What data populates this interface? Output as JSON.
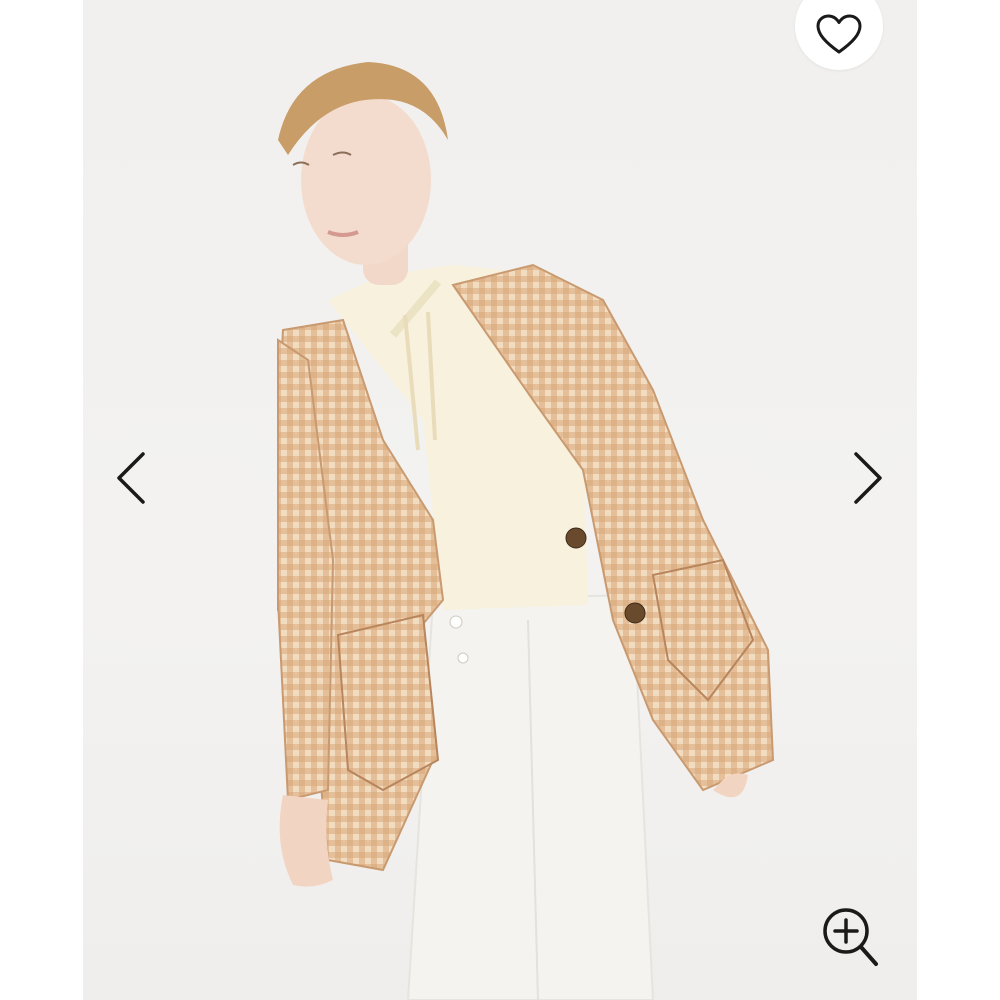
{
  "viewer": {
    "photo": {
      "description_icon": "product-photo"
    },
    "favorite": {
      "icon": "heart-icon"
    },
    "prev": {
      "icon": "chevron-left-icon"
    },
    "next": {
      "icon": "chevron-right-icon"
    },
    "zoom": {
      "icon": "zoom-in-icon"
    }
  },
  "colors": {
    "background": "#f2f1ef",
    "icon": "#1a1a1a",
    "jacket": "#d9b48e",
    "hoodie": "#f6f0dc",
    "jeans": "#f4f3ef"
  }
}
